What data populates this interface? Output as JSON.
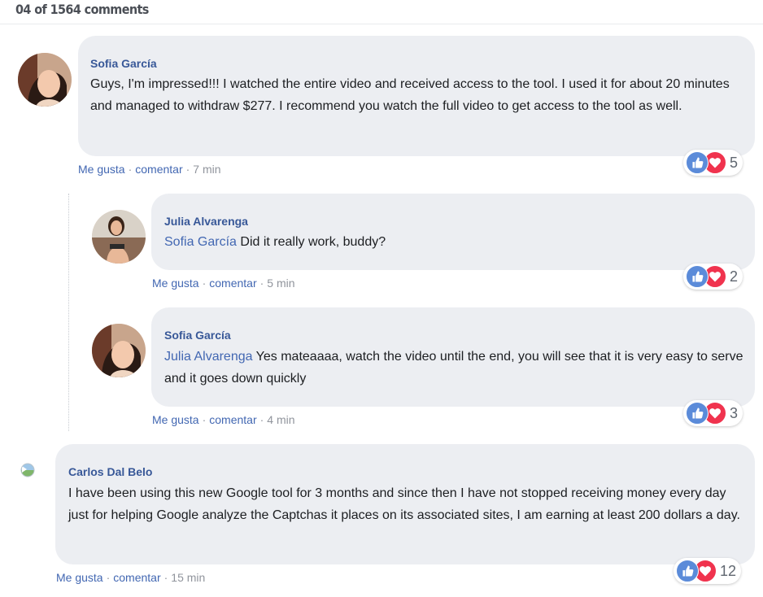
{
  "header": {
    "title": "04 of 1564 comments"
  },
  "comments": [
    {
      "author": "Sofia García",
      "mention": "",
      "text": "Guys, I'm impressed!!! I watched the entire video and received access to the tool. I used it for about 20 minutes and managed to withdraw $277. I recommend you watch the full video to get access to the tool as well.",
      "like": "Me gusta",
      "comment": "comentar",
      "time": "7 min",
      "reactions": "5"
    },
    {
      "author": "Julia Alvarenga",
      "mention": "Sofia García",
      "text": " Did it really work, buddy?",
      "like": "Me gusta",
      "comment": "comentar",
      "time": "5 min",
      "reactions": "2"
    },
    {
      "author": "Sofia García",
      "mention": "Julia Alvarenga",
      "text": " Yes mateaaaa, watch the video until the end, you will see that it is very easy to serve and it goes down quickly",
      "like": "Me gusta",
      "comment": "comentar",
      "time": "4 min",
      "reactions": "3"
    },
    {
      "author": "Carlos Dal Belo",
      "mention": "",
      "text": "I have been using this new Google tool for 3 months and since then I have not stopped receiving money every day just for helping Google analyze the Captchas it places on its associated sites, I am earning at least 200 dollars a day.",
      "like": "Me gusta",
      "comment": "comentar",
      "time": "15 min",
      "reactions": "12"
    }
  ],
  "separator": "·",
  "colors": {
    "link": "#385898",
    "bubble": "#eceef2",
    "like": "#5b8bd9",
    "love": "#f0334e"
  }
}
